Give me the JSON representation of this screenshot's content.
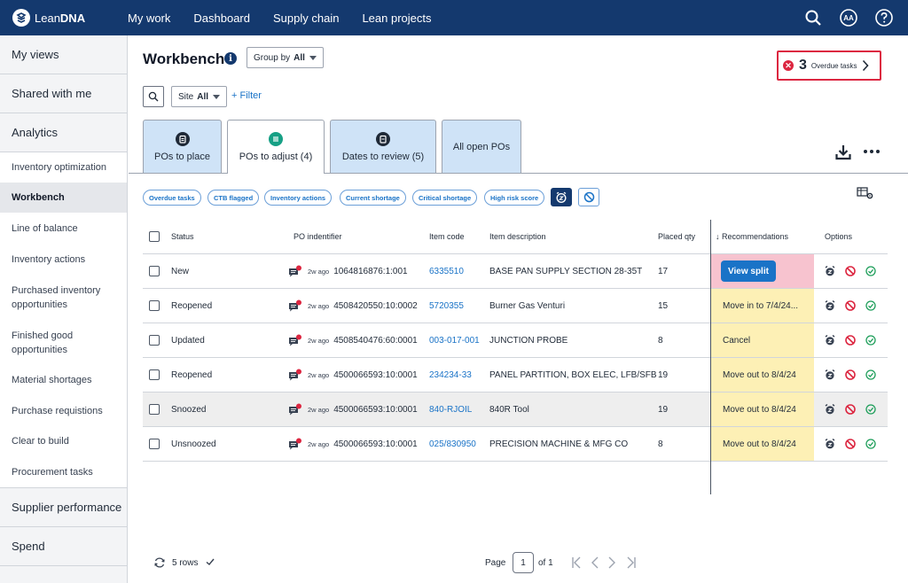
{
  "brand": {
    "name_prefix": "Lean",
    "name_bold": "DNA"
  },
  "nav": [
    "My work",
    "Dashboard",
    "Supply chain",
    "Lean projects"
  ],
  "user_initials": "AA",
  "sidebar": {
    "top_sections": [
      "My views",
      "Shared with me",
      "Analytics"
    ],
    "analytics_items": [
      "Inventory optimization",
      "Workbench",
      "Line of balance",
      "Inventory actions",
      "Purchased inventory opportunities",
      "Finished good opportunities",
      "Material shortages",
      "Purchase requistions",
      "Clear to build",
      "Procurement tasks"
    ],
    "bottom_sections": [
      "Supplier performance",
      "Spend"
    ]
  },
  "header": {
    "title": "Workbench",
    "info_icon": "i",
    "group_by_label": "Group by",
    "group_by_value": "All",
    "overdue_count": "3",
    "overdue_label": "Overdue tasks"
  },
  "filters": {
    "site_label": "Site",
    "site_value": "All",
    "filter_label": "+ Filter"
  },
  "tabs": [
    {
      "label": "POs to place"
    },
    {
      "label": "POs to adjust (4)"
    },
    {
      "label": "Dates to review (5)"
    },
    {
      "label": "All open POs"
    }
  ],
  "chips": [
    "Overdue tasks",
    "CTB flagged",
    "Inventory actions",
    "Current shortage",
    "Critical shortage",
    "High risk score"
  ],
  "table": {
    "columns": [
      "Status",
      "PO indentifier",
      "Item code",
      "Item description",
      "Placed qty",
      "↓ Recommendations",
      "Options"
    ],
    "rows": [
      {
        "status": "New",
        "ago": "2w ago",
        "po": "1064816876:1:001",
        "item_code": "6335510",
        "description": "BASE PAN SUPPLY SECTION 28-35T",
        "qty": "17",
        "recommendation": "View split"
      },
      {
        "status": "Reopened",
        "ago": "2w ago",
        "po": "4508420550:10:0002",
        "item_code": "5720355",
        "description": "Burner Gas Venturi",
        "qty": "15",
        "recommendation": "Move in to 7/4/24..."
      },
      {
        "status": "Updated",
        "ago": "2w ago",
        "po": "4508540476:60:0001",
        "item_code": "003-017-001",
        "description": "JUNCTION PROBE",
        "qty": "8",
        "recommendation": "Cancel"
      },
      {
        "status": "Reopened",
        "ago": "2w ago",
        "po": "4500066593:10:0001",
        "item_code": "234234-33",
        "description": "PANEL PARTITION, BOX ELEC, LFB/SFB",
        "qty": "19",
        "recommendation": "Move out to 8/4/24"
      },
      {
        "status": "Snoozed",
        "ago": "2w ago",
        "po": "4500066593:10:0001",
        "item_code": "840-RJOIL",
        "description": "840R Tool",
        "qty": "19",
        "recommendation": "Move out to 8/4/24"
      },
      {
        "status": "Unsnoozed",
        "ago": "2w ago",
        "po": "4500066593:10:0001",
        "item_code": "025/830950",
        "description": "PRECISION MACHINE & MFG CO",
        "qty": "8",
        "recommendation": "Move out to 8/4/24"
      }
    ]
  },
  "footer": {
    "rows_label": "5 rows",
    "page_label": "Page",
    "page_value": "1",
    "of_label": "of 1"
  },
  "colors": {
    "navy": "#14396e",
    "link": "#1a73c7",
    "reco_yellow": "#fdf0b5",
    "reco_pink": "#f7c3cf",
    "alert_red": "#dc2640",
    "tab_blue": "#cfe3f7"
  },
  "icons": [
    "search-icon",
    "user-avatar-icon",
    "help-icon",
    "info-icon",
    "download-icon",
    "more-icon",
    "grid-settings-icon",
    "snooze-clock-icon",
    "block-icon",
    "check-circle-icon",
    "comment-icon",
    "refresh-icon"
  ]
}
